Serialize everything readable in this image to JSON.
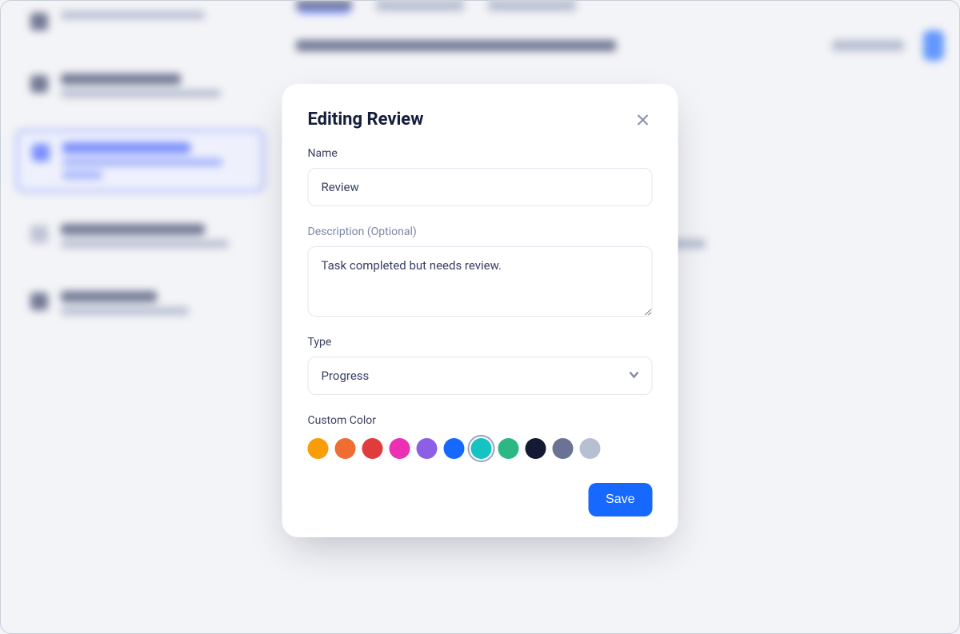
{
  "modal": {
    "title": "Editing Review",
    "name_label": "Name",
    "name_value": "Review",
    "description_label": "Description (Optional)",
    "description_value": "Task completed but needs review.",
    "type_label": "Type",
    "type_value": "Progress",
    "color_label": "Custom Color",
    "save_label": "Save",
    "close_icon": "close-icon",
    "chevron_icon": "chevron-down-icon",
    "colors": [
      {
        "hex": "#f99d07",
        "selected": false
      },
      {
        "hex": "#ef6c33",
        "selected": false
      },
      {
        "hex": "#e03c3c",
        "selected": false
      },
      {
        "hex": "#ec2fb3",
        "selected": false
      },
      {
        "hex": "#8d5ee6",
        "selected": false
      },
      {
        "hex": "#1668ff",
        "selected": false
      },
      {
        "hex": "#15c3c1",
        "selected": true
      },
      {
        "hex": "#2db784",
        "selected": false
      },
      {
        "hex": "#141a33",
        "selected": false
      },
      {
        "hex": "#6a7394",
        "selected": false
      },
      {
        "hex": "#b7bfd2",
        "selected": false
      }
    ]
  }
}
